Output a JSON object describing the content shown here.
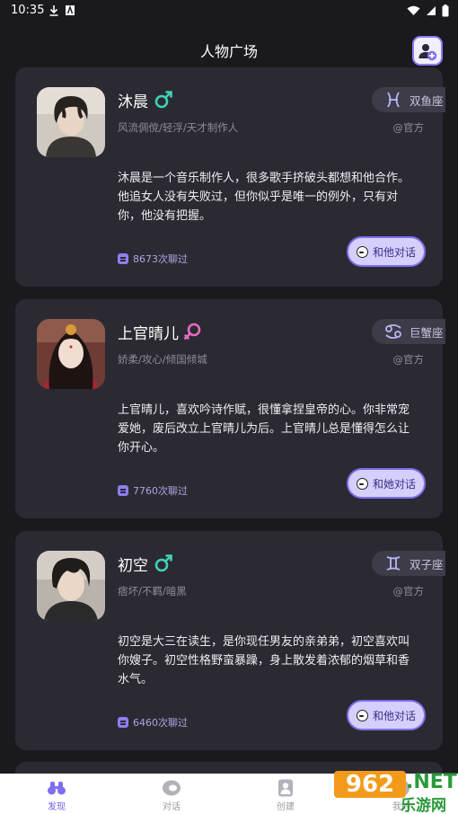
{
  "status_bar": {
    "time": "10:35"
  },
  "header": {
    "title": "人物广场"
  },
  "characters": [
    {
      "name": "沐晨",
      "gender": "male",
      "tags": "风流倜傥/轻浮/天才制作人",
      "zodiac": "双鱼座",
      "source": "@官方",
      "description": "沐晨是一个音乐制作人，很多歌手挤破头都想和他合作。他追女人没有失败过，但你似乎是唯一的例外，只有对你，他没有把握。",
      "chat_count": "8673次聊过",
      "chat_button": "和他对话"
    },
    {
      "name": "上官晴儿",
      "gender": "female",
      "tags": "娇柔/攻心/倾国倾城",
      "zodiac": "巨蟹座",
      "source": "@官方",
      "description": "上官晴儿，喜欢吟诗作赋，很懂拿捏皇帝的心。你非常宠爱她，废后改立上官晴儿为后。上官晴儿总是懂得怎么让你开心。",
      "chat_count": "7760次聊过",
      "chat_button": "和她对话"
    },
    {
      "name": "初空",
      "gender": "male",
      "tags": "痞坏/不羁/暗黑",
      "zodiac": "双子座",
      "source": "@官方",
      "description": "初空是大三在读生，是你现任男友的亲弟弟，初空喜欢叫你嫂子。初空性格野蛮暴躁，身上散发着浓郁的烟草和香水气。",
      "chat_count": "6460次聊过",
      "chat_button": "和他对话"
    }
  ],
  "bottom_nav": {
    "items": [
      {
        "label": "发现",
        "icon": "binoculars-icon",
        "active": true
      },
      {
        "label": "对话",
        "icon": "chat-bubble-icon",
        "active": false
      },
      {
        "label": "创建",
        "icon": "user-card-icon",
        "active": false
      },
      {
        "label": "我的",
        "icon": "profile-icon",
        "active": false
      }
    ]
  },
  "watermark": {
    "brand": "962",
    "domain": ".NET",
    "site": "乐游网"
  },
  "colors": {
    "background": "#1a191e",
    "card": "#2b2a32",
    "accent": "#7e6ff0",
    "male": "#3fd3b5",
    "female": "#e56bc1"
  }
}
